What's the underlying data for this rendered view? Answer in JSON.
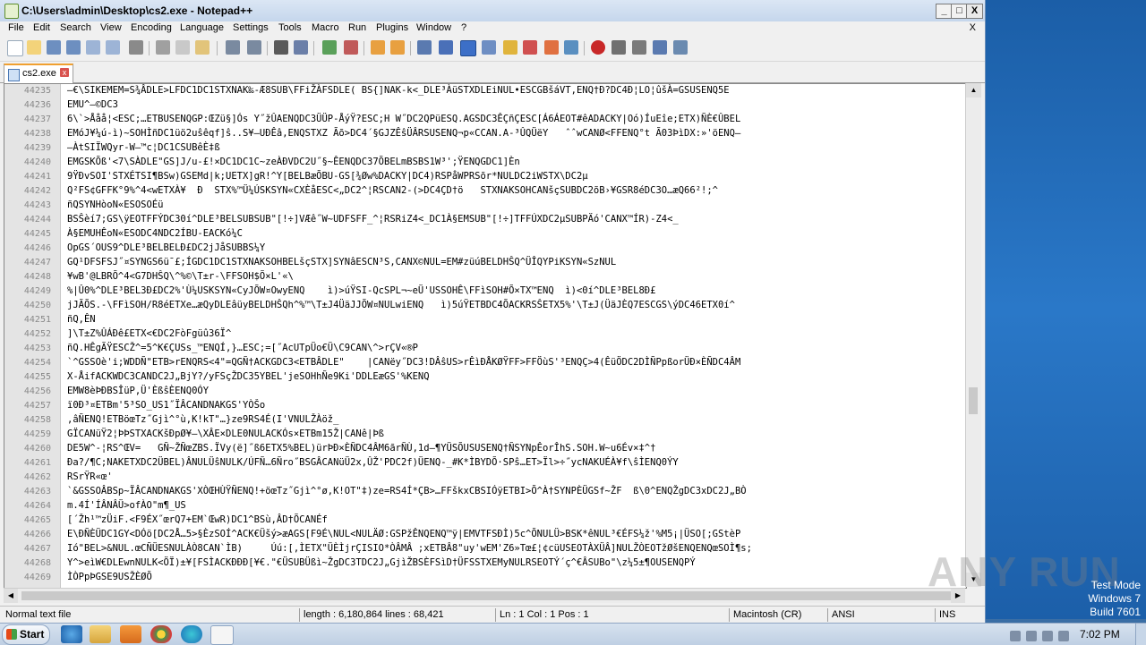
{
  "window": {
    "title": "C:\\Users\\admin\\Desktop\\cs2.exe - Notepad++",
    "min": "_",
    "max": "□",
    "close": "X"
  },
  "menu": {
    "items": [
      "File",
      "Edit",
      "Search",
      "View",
      "Encoding",
      "Language",
      "Settings",
      "Tools",
      "Macro",
      "Run",
      "Plugins",
      "Window",
      "?"
    ],
    "close": "X"
  },
  "tab": {
    "label": "cs2.exe",
    "close": "x"
  },
  "editor": {
    "lines": [
      {
        "n": "44235",
        "t": "—€\\SIKEMEM=S¾ÂDLE>LFDC1DC1STXNAK‰-Æ8SUB\\FFiŽÀFSDLE( BS{]NAK-k<_DLE³ÀüSTXDLEiNUL•ESCGBšáVT,ENQ†Ð?DC4Ð¦LO¦ûšÀ=GSUSENQ5E"
      },
      {
        "n": "44236",
        "t": "EMU^—©DC3"
      },
      {
        "n": "44237",
        "t": "6\\`>Ååå¦<ESC;…ETBUSENQGP:ŒZü§]Ós Y˝žÛAENQDC3ÜÜP-ÅýŸ?ESC;H W˝DC2QPüESQ.AGSDC3ÊÇñÇESC[Á6ÁEOT#êADACKY|Oó)ÍuEîe;ETX)ÑÈ€ÛBEL"
      },
      {
        "n": "44238",
        "t": "EMóJ¥¼ú-ì)~SOHÌñDC1üö2uŝêqf]ŝ..S¥–UÐÊâ,ENQSTXZ Ãõ>DC4´§GJZÊŝÜÂRSUSENQ¬p«CCAN.A-³ÛQÜëY   ˆˆwCANØ<FFENQ°t Ã03ÞìDX:»'öENQ—"
      },
      {
        "n": "44239",
        "t": "—ÀtSIÏWQyr-W—™c¦DC1CSUBêÈ‡ß"
      },
      {
        "n": "44240",
        "t": "EMGSKÕß'<7\\SÀDLE\"GS]J/u-£!×DC1DC1C~zeÀÐVDC2U˝§~ÊENQDC37ÕBELmBSBS1W³';ŸENQGDC1]Èn"
      },
      {
        "n": "44241",
        "t": "9ŸÐvSOI'STXÉTSI¶BSw)GSEMd|k;UETX]gR!^Y[BELBæÕBU-GS[¾Øw%DACKY|DC4)RSPåWPRSõr*NULDC2iWSTX\\DC2µ"
      },
      {
        "n": "44242",
        "t": "Q²FS¢GFFK°9%^4<wETXÀ¥  Ð  STX%™Ü¼ÚSKSYN«CXÈåESC<„DC2^¦RSCAN2-(>DC4ÇD†ö   STXNAKSOHCANšçSUBDC2õB›¥GSR8éDC3O…æQ66²!;^"
      },
      {
        "n": "44243",
        "t": "ñQSYNHòoN«ESOSOÉü"
      },
      {
        "n": "44244",
        "t": "BSŜèí7;GS\\ÿEOTFFÝDC30í^DLE³BELSUBSUB\"[!÷]VÆê˝W~UDFSFF_^¦RSRiZ4<_DC1À§EMSUB\"[!÷]TFFÚXDC2µSUBPÄó'CANX™ÍR)-Z4<_"
      },
      {
        "n": "44245",
        "t": "À§EMUHÊoN«ESODC4NDC2ÍBU-EACKó¼C"
      },
      {
        "n": "44246",
        "t": "OpGS´OUS9^DLE³BELBELÐ£DC2jJåSUBBS¼Y"
      },
      {
        "n": "44247",
        "t": "GQ¹DFSFSJ˝¤SYNGS6ü¯£;ÍGDC1DC1STXNAKSOHBELšçSTX]SYNâESCN³S,CANX©NUL=EM#züúBELDHŜQ^ÜÎQYPiKSYN«SzNUL"
      },
      {
        "n": "44248",
        "t": "¥wB'@LBRÕ^4<G7DHŜQ\\^%©\\T±r-\\FFSOH$Õ×L'«\\"
      },
      {
        "n": "44249",
        "t": "%|Û0%^DLE³BEL3Ð£DC2%'Ù¼USKSYN«CyJÕW¤OwyENQ    ì)>úŸSI-QcSPL¬~eÜ'USSOHÊ\\FFìSOH#Õ×TX™ENQ  ì)<0í^DLE³BEL8Ð£"
      },
      {
        "n": "44250",
        "t": "jJÃÕS.-\\FFìSOH/R8éETXe…æQyDLEâüyBELDHŜQh^%™\\T±J4ÜäJJÕW¤NULwiENQ   ì)5úŸETBDC4ÕACKRSŜETX5%'\\T±J(ÜäJÈQ7ESCGS\\ýDC46ETX0í^"
      },
      {
        "n": "44251",
        "t": "ñQ,ÊN"
      },
      {
        "n": "44252",
        "t": "]\\T±Z%ÛÁÐê£ETX<€DC2FòFgüû36Ï^"
      },
      {
        "n": "44253",
        "t": "ñQ.HÊgÃŸESCŽ^=5^K€ÇUSs_™ENQÍ,}…ESC;=[˝AcUTpÜo€Ü\\C9CAN\\^>rÇV«®P"
      },
      {
        "n": "44254",
        "t": "`^GSSOè'i;WDDÑ\"ETB>rENQRS<4\"=QGÑ†ACKGDC3<ETBÂDLE\"    |CANëy˝DC3!DÂŝUS>rÊìÐÅKØŸFF>FFÖùS'³ENQÇ>4(ÊüÖDC2DÌÑPpßorÜÐ×ÈÑDC4ÂM"
      },
      {
        "n": "44255",
        "t": "X-ÅifACKWDC3CANDC2J„BjY?/yFSçŽDC35YBEL'jeSOHhÑe9Ki'DDLEæGS'%KENQ"
      },
      {
        "n": "44256",
        "t": "EMW8èÞÐBSÎüP,Ü'ÈßŝÈENQ0ÓY"
      },
      {
        "n": "44257",
        "t": "ï0Ð³¤ETBm'5³SO_US1˝ÏÂCANDNAKGS'YÒŠo"
      },
      {
        "n": "44258",
        "t": ",âÑENQ!ETBöœTz˝Gjì^°ù,K!kT\"…}ze9RS4É(I'VNULŽÀöž_"
      },
      {
        "n": "44259",
        "t": "GÏCANüŸ2¦ÞÞSTXACKšÐpØ¥—\\XÂE×DLE0NULACKÓs×ETBm15Ž|CANê|Þß"
      },
      {
        "n": "44260",
        "t": "DE5W^-¦RS^ŒV=   GÑ~ŽÑœZBS.ÏVy(ë]˝ß6ETX5%BEL)ürÞÐ×ÈÑDC4ÂM6ãrÑÙ,1d—¶YÜSÕUSUSENQ†ÑSYNpÊorÎhS.SOH.W~u6Év×‡^†"
      },
      {
        "n": "44261",
        "t": "Ðа?/¶C;NAKETXDC2ÜBEL)ÂNULÜŝNULK/ÚFÑ…6Ñro˝BSGÂCANüÜ2x,ÛŽ'PDC2f)ÜENQ-_#K*ÌBYDÕ·SPŝ…ET>Ïl>÷˝ycNAKUÉÀ¥f\\ŝÌENQ0ÝY"
      },
      {
        "n": "44262",
        "t": "RSrŸR«œ'"
      },
      {
        "n": "44263",
        "t": "`&GSSOÂBSp~ÏÂCANDNAKGS'XÒŒHÙŸÑENQ!+öœTz˝Gjì^°ø,K!OT\"‡)ze=RS4Í*ÇB>…FFškxCBSIÓÿETBI>Õ^À†SYNPÈÜGSf~ŽF  ß\\0^ENQŽgDC3xDC2J„BÒ"
      },
      {
        "n": "44264",
        "t": "m.4Í'ÍÂNÂÜ>ofÀO\"m¶_US"
      },
      {
        "n": "44265",
        "t": "[´Žh¹™zÜiF.<F9ÉX˝œrQ7+EM`ŒwR)DC1^BSù,ÂD†ÕCANÉf"
      },
      {
        "n": "44266",
        "t": "E\\ÐÑÈÜDC1GY<DÓö[DC2Å…5>§ÈzSOÍ^ACK€Üšý>æAGS[F9É\\NUL<NULÄØ:GSPžÊNQENQ™ÿ|EMVTFSÐÌ)5c^ÕNULÜ>BSK*êNUL³€ÉFS¼ž'%M5¡|ÜSO[;GStèP"
      },
      {
        "n": "44267",
        "t": "Ió\"BEL>&NUL.œCÑÜESNULÀÒ8CAN`ÌB)     Úú:[,ÌETX\"ÜÈÌjrÇISIO*ÒÂMÂ ;xETBÂ8\"uy'wEM'Z6»Tœ£¦¢cüUSEOTÀXÜÂ]NULŽÒEOTžØšENQENQœSOÌ¶s;"
      },
      {
        "n": "44268",
        "t": "Y^>eìW€DLEwnNULK<ÖÏ)±¥[FSÌACKÐÐÐ[¥€.\"€ÜSUBÜßì~ŽgDC3TDC2J„GjìŽBSÈFSìD†ÜFSSTXEMyNULRSEOTÝ´ç^€ÂSUBo\"\\z¼5±¶OUSENQPÝ"
      },
      {
        "n": "44269",
        "t": "ÌÒPpÞGSE9USŽÈØÕ"
      }
    ]
  },
  "statusbar": {
    "type": "Normal text file",
    "length": "length : 6,180,864   lines : 68,421",
    "pos": "Ln : 1   Col : 1   Pos : 1",
    "eol": "Macintosh (CR)",
    "enc": "ANSI",
    "mode": "INS"
  },
  "watermark": "ANY RUN",
  "os": {
    "line1": "Test Mode",
    "line2": "Windows 7",
    "line3": "Build 7601"
  },
  "taskbar": {
    "start": "Start",
    "time": "7:02 PM"
  }
}
